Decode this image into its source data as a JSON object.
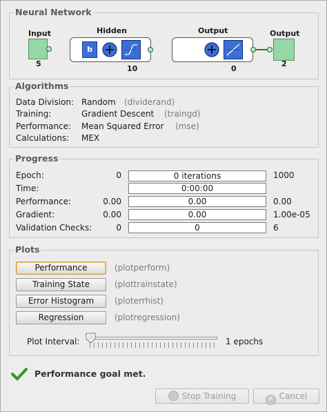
{
  "network": {
    "legend": "Neural Network",
    "input_title": "Input",
    "input_size": "5",
    "hidden_title": "Hidden",
    "hidden_size": "10",
    "output_layer_title": "Output",
    "output_layer_size": "0",
    "output_title": "Output",
    "output_size": "2",
    "bias_label": "b",
    "node_color": "#93d8a6",
    "weight_color": "#3b6fd6"
  },
  "algorithms": {
    "legend": "Algorithms",
    "rows": [
      {
        "label": "Data Division:",
        "value": "Random",
        "func": "(dividerand)"
      },
      {
        "label": "Training:",
        "value": "Gradient Descent",
        "func": "(traingd)"
      },
      {
        "label": "Performance:",
        "value": "Mean Squared Error",
        "func": "(mse)"
      },
      {
        "label": "Calculations:",
        "value": "MEX",
        "func": ""
      }
    ]
  },
  "progress": {
    "legend": "Progress",
    "rows": [
      {
        "label": "Epoch:",
        "start": "0",
        "current": "0 iterations",
        "end": "1000"
      },
      {
        "label": "Time:",
        "start": "",
        "current": "0:00:00",
        "end": ""
      },
      {
        "label": "Performance:",
        "start": "0.00",
        "current": "0.00",
        "end": "0.00"
      },
      {
        "label": "Gradient:",
        "start": "0.00",
        "current": "0.00",
        "end": "1.00e-05"
      },
      {
        "label": "Validation Checks:",
        "start": "0",
        "current": "0",
        "end": "6"
      }
    ]
  },
  "plots": {
    "legend": "Plots",
    "buttons": [
      {
        "label": "Performance",
        "func": "(plotperform)"
      },
      {
        "label": "Training State",
        "func": "(plottrainstate)"
      },
      {
        "label": "Error Histogram",
        "func": "(ploterrhist)"
      },
      {
        "label": "Regression",
        "func": "(plotregression)"
      }
    ],
    "interval_label": "Plot Interval:",
    "interval_value": "1 epochs",
    "slider_level": 0
  },
  "status": {
    "icon": "check-icon",
    "text": "Performance goal met.",
    "color": "#2e9a2e"
  },
  "footer": {
    "stop_label": "Stop Training",
    "cancel_label": "Cancel"
  }
}
